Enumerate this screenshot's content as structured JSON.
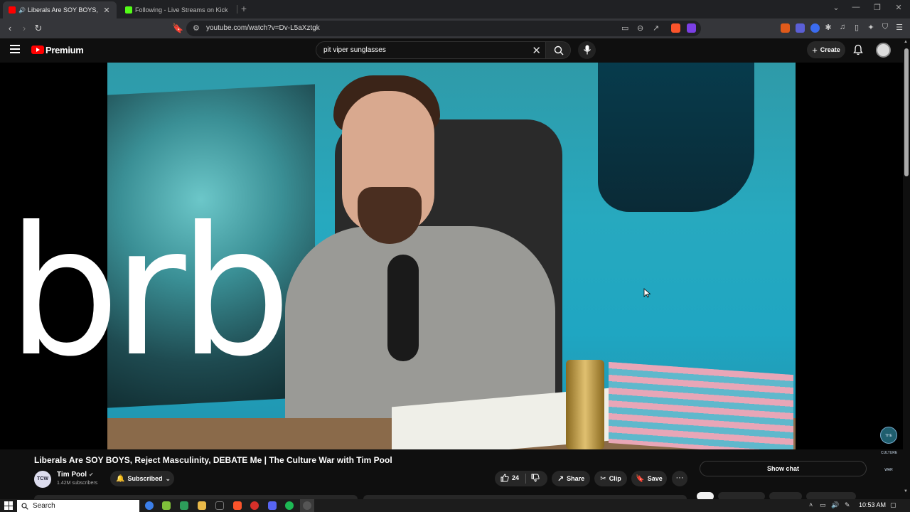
{
  "browser": {
    "tabs": [
      {
        "label": "Liberals Are SOY BOYS, Rejec",
        "active": true
      },
      {
        "label": "Following - Live Streams on Kick",
        "active": false
      }
    ],
    "url": "youtube.com/watch?v=Dv-L5aXztgk"
  },
  "youtube": {
    "brand": "Premium",
    "search_value": "pit viper sunglasses",
    "create_label": "Create"
  },
  "video": {
    "overlay_text": "brb",
    "channel_watermark": "THE CULTURE WAR",
    "title": "Liberals Are SOY BOYS, Reject Masculinity, DEBATE Me | The Culture War with Tim Pool"
  },
  "channel": {
    "avatar_text": "TCW",
    "name": "Tim Pool",
    "subscribers": "1.42M subscribers",
    "subscribe_label": "Subscribed"
  },
  "actions": {
    "like_count": "24",
    "share_label": "Share",
    "clip_label": "Clip",
    "save_label": "Save",
    "more_label": "···"
  },
  "chat": {
    "show_chat_label": "Show chat"
  },
  "taskbar": {
    "search_label": "Search",
    "time": "10:53 AM"
  },
  "colors": {
    "youtube_red": "#ff0000",
    "kick_green": "#53fc18",
    "page_bg": "#0f0f0f"
  }
}
